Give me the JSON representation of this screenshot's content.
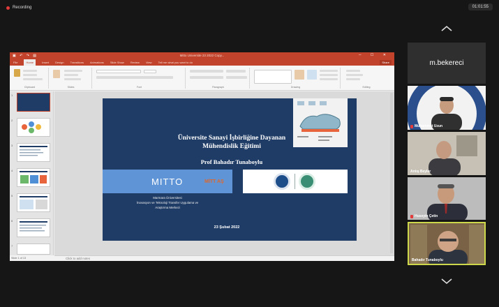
{
  "recording": {
    "label": "Recording",
    "timer": "01:01:55"
  },
  "ppt": {
    "window_title": "Mitto Universite 23 2022 Copy...",
    "tabs": [
      "File",
      "Home",
      "Insert",
      "Design",
      "Transitions",
      "Animations",
      "Slide Show",
      "Review",
      "View",
      "Tell me what you want to do"
    ],
    "share_label": "Share",
    "ribbon_groups": [
      "Clipboard",
      "Slides",
      "Font",
      "Paragraph",
      "Drawing",
      "Editing"
    ],
    "notes_placeholder": "Click to add notes",
    "status_text": "Slide 1 of 13",
    "slide": {
      "title_line1": "Üniversite Sanayi İşbirliğine Dayanan",
      "title_line2": "Mühendislik Eğitimi",
      "author": "Prof Bahadır Tunaboylu",
      "mitto": "MITTO",
      "mittas": "MİTT AŞ",
      "university": "Marmara Üniversitesi",
      "center_line1": "İnovasyon ve Teknoloji Transfer Uygulama ve",
      "center_line2": "Araştırma Merkezi",
      "date": "23 Şubat 2022"
    }
  },
  "participants": [
    {
      "name": "m.bekereci",
      "kind": "name-only"
    },
    {
      "name": "Muhammet Uzun",
      "kind": "video"
    },
    {
      "name": "Antış Beyler",
      "kind": "video"
    },
    {
      "name": "Huseyin Çetin",
      "kind": "video"
    },
    {
      "name": "Bahadır Tunaboylu",
      "kind": "video",
      "active": true
    }
  ],
  "colors": {
    "ppt_accent": "#c1432b",
    "slide_bg": "#1f3c66",
    "slide_band": "#5f94d6",
    "active_speaker": "#cdd84a",
    "record_dot": "#e23b3b"
  }
}
